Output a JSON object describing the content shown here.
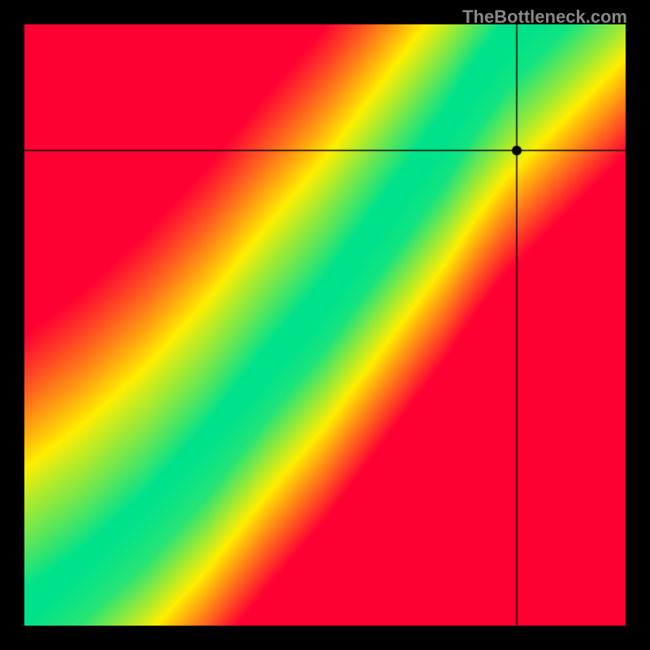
{
  "watermark": "TheBottleneck.com",
  "chart_data": {
    "type": "heatmap",
    "title": "",
    "xlabel": "",
    "ylabel": "",
    "x_range": [
      0,
      100
    ],
    "y_range": [
      0,
      100
    ],
    "marker": {
      "x": 82,
      "y": 79
    },
    "crosshair": {
      "x": 82,
      "y": 79
    },
    "optimal_curve_description": "S-shaped green band from lower-left to upper-right; marker at (82,79) lies slightly right of the green band in yellow/orange region",
    "color_stops": {
      "worst": "#ff0033",
      "mid": "#ffee00",
      "best": "#00e28a"
    },
    "optimal_curve_points": [
      {
        "x": 0,
        "y": 0
      },
      {
        "x": 10,
        "y": 7
      },
      {
        "x": 20,
        "y": 16
      },
      {
        "x": 30,
        "y": 27
      },
      {
        "x": 40,
        "y": 40
      },
      {
        "x": 50,
        "y": 52
      },
      {
        "x": 60,
        "y": 66
      },
      {
        "x": 70,
        "y": 80
      },
      {
        "x": 75,
        "y": 88
      },
      {
        "x": 80,
        "y": 95
      },
      {
        "x": 85,
        "y": 100
      }
    ],
    "band_half_width": 6
  }
}
